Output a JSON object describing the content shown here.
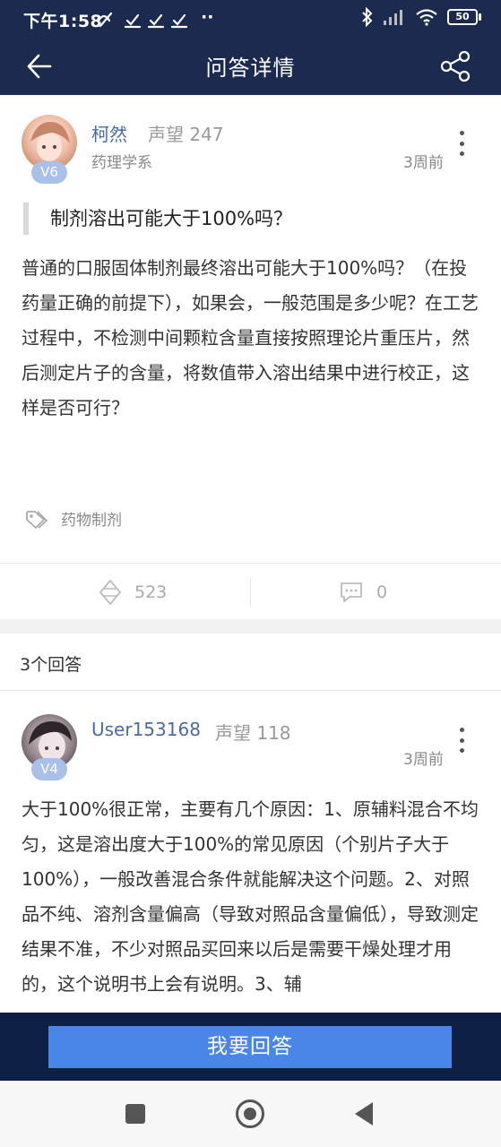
{
  "status_bar": {
    "time": "下午1:58",
    "battery": "50"
  },
  "nav": {
    "title": "问答详情"
  },
  "question": {
    "author": {
      "name": "柯然",
      "reputation": "声望 247",
      "level": "V6",
      "department": "药理学系"
    },
    "time": "3周前",
    "title": "制剂溶出可能大于100%吗？",
    "body": "普通的口服固体制剂最终溶出可能大于100%吗？（在投药量正确的前提下），如果会，一般范围是多少呢？在工艺过程中，不检测中间颗粒含量直接按照理论片重压片，然后测定片子的含量，将数值带入溶出结果中进行校正，这样是否可行？",
    "tag": "药物制剂",
    "views": "523",
    "comments": "0"
  },
  "answers": {
    "count_label": "3个回答",
    "items": [
      {
        "author": {
          "name": "User153168",
          "reputation": "声望 118",
          "level": "V4"
        },
        "time": "3周前",
        "body": "大于100%很正常，主要有几个原因：1、原辅料混合不均匀，这是溶出度大于100%的常见原因（个别片子大于100%），一般改善混合条件就能解决这个问题。2、对照品不纯、溶剂含量偏高（导致对照品含量偏低），导致测定结果不准，不少对照品买回来以后是需要干燥处理才用的，这个说明书上会有说明。3、辅"
      }
    ]
  },
  "bottom": {
    "answer_button": "我要回答"
  },
  "colors": {
    "header_bg": "#1b2a4e",
    "accent": "#4a86e8",
    "author_name": "#4a6aa6",
    "level_badge": "#a9c1e8"
  }
}
